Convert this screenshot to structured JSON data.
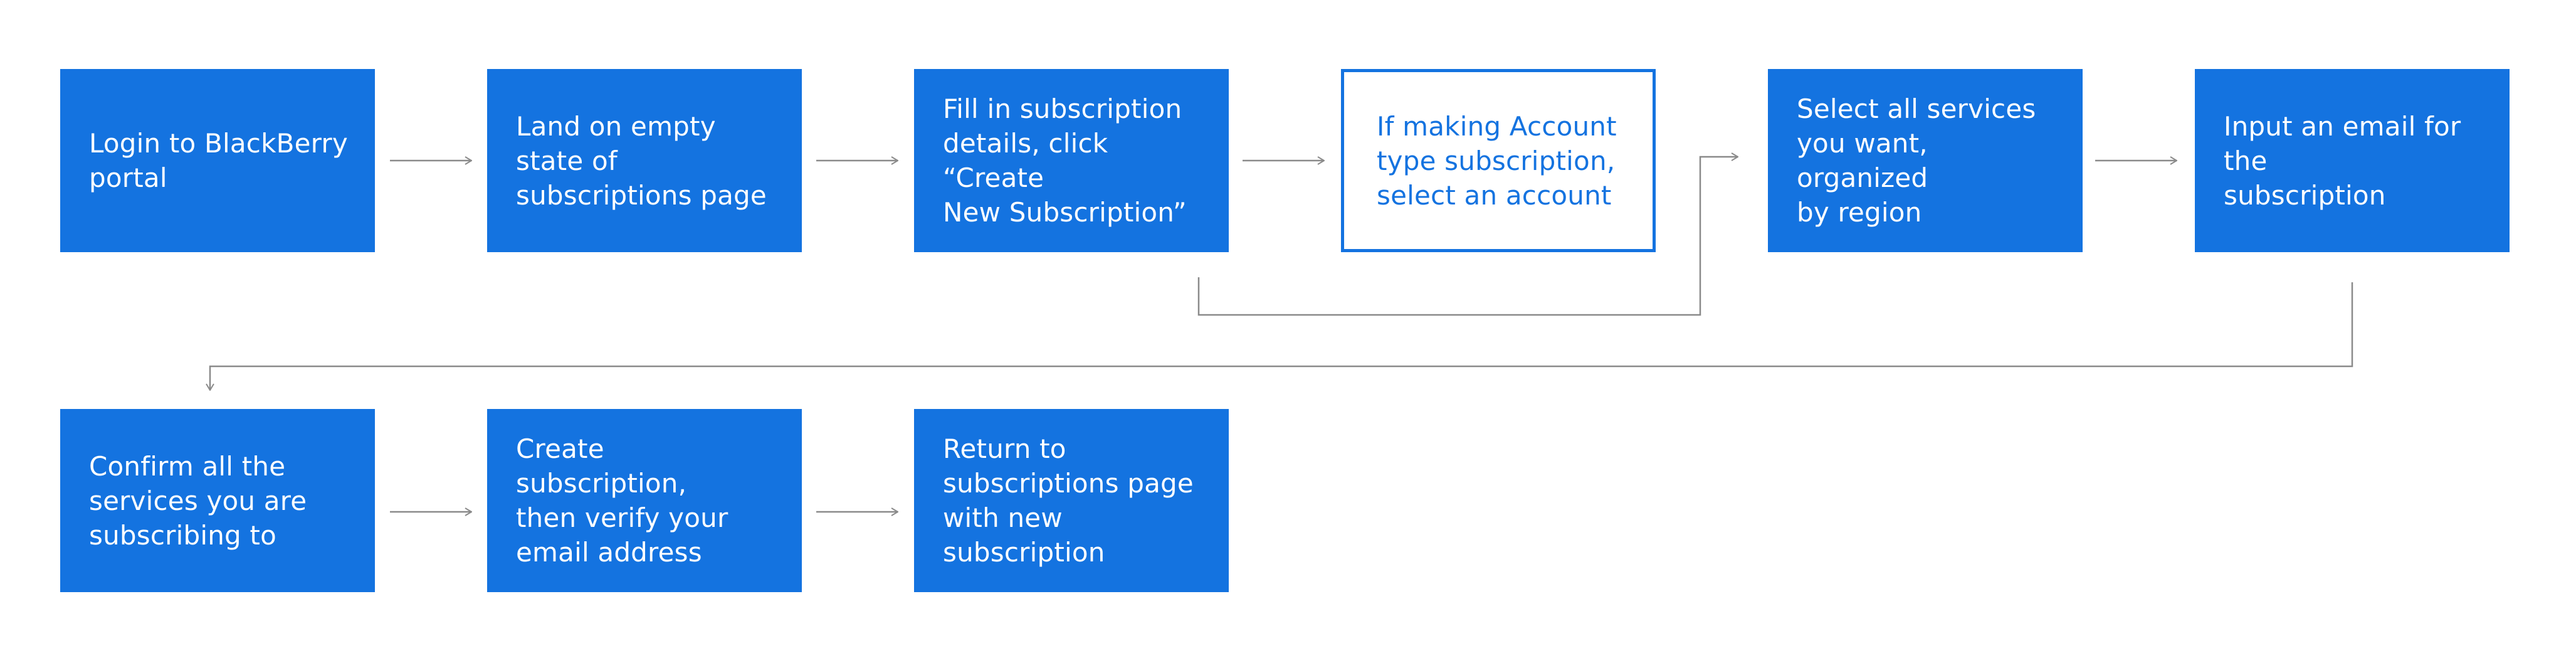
{
  "colors": {
    "node_fill": "#1473e0",
    "node_text": "#ffffff",
    "outline_node_text": "#1473e0",
    "connector": "#8a8a8a",
    "background": "#ffffff"
  },
  "steps": [
    {
      "text": "Login to BlackBerry\nportal",
      "style": "filled"
    },
    {
      "text": "Land on empty\nstate of\nsubscriptions page",
      "style": "filled"
    },
    {
      "text": "Fill in subscription\ndetails, click “Create\nNew Subscription”",
      "style": "filled"
    },
    {
      "text": "If making Account\ntype subscription,\nselect an account",
      "style": "outlined"
    },
    {
      "text": "Select all services\nyou want, organized\nby region",
      "style": "filled"
    },
    {
      "text": "Input an email for the\nsubscription",
      "style": "filled"
    },
    {
      "text": "Confirm all the\nservices you are\nsubscribing to",
      "style": "filled"
    },
    {
      "text": "Create subscription,\nthen verify your\nemail address",
      "style": "filled"
    },
    {
      "text": "Return to\nsubscriptions page\nwith new subscription",
      "style": "filled"
    }
  ]
}
